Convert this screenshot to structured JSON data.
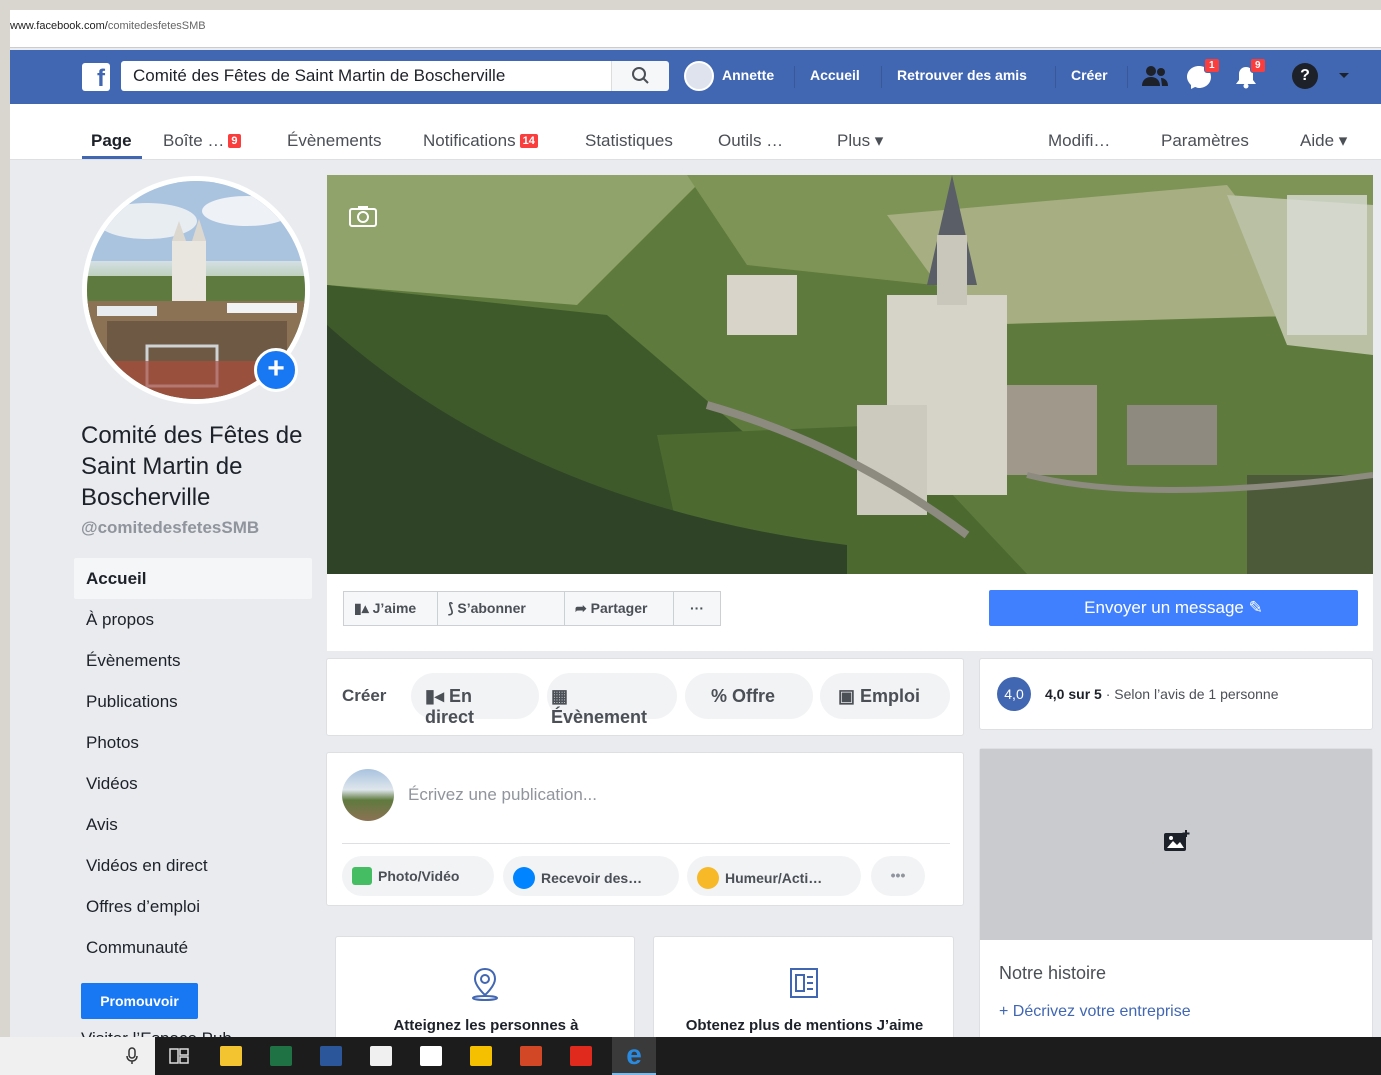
{
  "browser": {
    "url_host": "www.facebook.com/",
    "url_path": "comitedesfetesSMB"
  },
  "topbar": {
    "logo": "f",
    "search_value": "Comité des Fêtes de Saint Martin de Boscherville",
    "user_name": "Annette",
    "links": [
      "Accueil",
      "Retrouver des amis",
      "Créer"
    ],
    "messages_badge": "1",
    "notifications_badge": "9",
    "help": "?"
  },
  "page_tabs": {
    "page": "Page",
    "inbox": "Boîte …",
    "inbox_badge": "9",
    "events": "Évènements",
    "notifications": "Notifications",
    "notifications_badge": "14",
    "stats": "Statistiques",
    "tools": "Outils …",
    "more": "Plus ▾",
    "edit": "Modifi…",
    "settings": "Paramètres",
    "help": "Aide ▾"
  },
  "sidebar": {
    "page_name": "Comité des Fêtes de Saint Martin de Boscherville",
    "handle": "@comitedesfetesSMB",
    "items": [
      "Accueil",
      "À propos",
      "Évènements",
      "Publications",
      "Photos",
      "Vidéos",
      "Avis",
      "Vidéos en direct",
      "Offres d’emploi",
      "Communauté"
    ],
    "promote": "Promouvoir",
    "visit": "Visiter l’Espace Pub…"
  },
  "actions": {
    "like": "J’aime",
    "follow": "S’abonner",
    "share": "Partager",
    "more": "···",
    "message": "Envoyer un message ✎"
  },
  "create": {
    "label": "Créer",
    "live": "En direct",
    "event": "Évènement",
    "offer": "Offre",
    "job": "Emploi"
  },
  "composer": {
    "placeholder": "Écrivez une publication...",
    "photo": "Photo/Vidéo",
    "messages": "Recevoir des…",
    "feeling": "Humeur/Acti…",
    "more": "•••"
  },
  "promo_cards": {
    "left": "Atteignez les personnes à",
    "right": "Obtenez plus de mentions J’aime"
  },
  "rating": {
    "score": "4,0",
    "text_bold": "4,0 sur 5",
    "text_rest": " · Selon l’avis de 1 personne"
  },
  "story": {
    "title": "Notre histoire",
    "link": "+ Décrivez votre entreprise"
  },
  "colors": {
    "facebook_blue": "#4267b2",
    "button_blue": "#4080ff",
    "badge_red": "#fa3e3e"
  }
}
